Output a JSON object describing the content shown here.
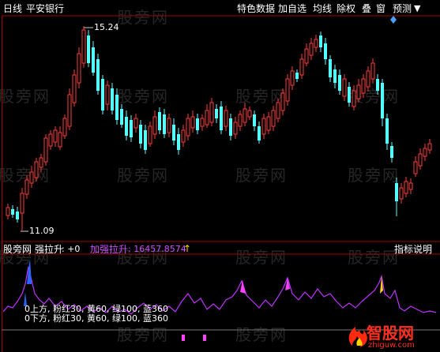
{
  "header": {
    "period_label": "日线",
    "stock_name": "平安银行"
  },
  "toolbar": {
    "buttons": [
      {
        "label": "特色数据"
      },
      {
        "label": "加自选"
      },
      {
        "label": "均线"
      },
      {
        "label": "除权"
      },
      {
        "label": "叠"
      },
      {
        "label": "窗"
      },
      {
        "label": "预测"
      }
    ]
  },
  "price_chart": {
    "high_label": "15.24",
    "low_label": "11.09"
  },
  "indicator": {
    "site_label": "股旁网",
    "name_label": "强拉升",
    "value_label": ": +0",
    "line2_label": "加强拉升",
    "line2_value": ": 16457.8574",
    "arrow_glyph": "↑",
    "explain_button": "指标说明",
    "note_line1": "0上方, 粉红30, 黄60, 绿100, 蓝360",
    "note_line2": "0下方, 粉红30, 黄60, 绿100, 蓝360"
  },
  "watermark": {
    "text": "股旁网",
    "brand": "智股网",
    "brand_url": "zhiguw.com"
  },
  "colors": {
    "up_candle": "#ff3a3a",
    "down_candle": "#54ffff",
    "grid": "#a00000",
    "indicator_line": "#c030ff",
    "highlight": "#ffd020",
    "marker_blue": "#2a64ff",
    "marker_magenta": "#ff40ff"
  },
  "icons": [
    "diamond-marker-icon",
    "triangle-marker-icon",
    "flame-logo-icon"
  ]
}
